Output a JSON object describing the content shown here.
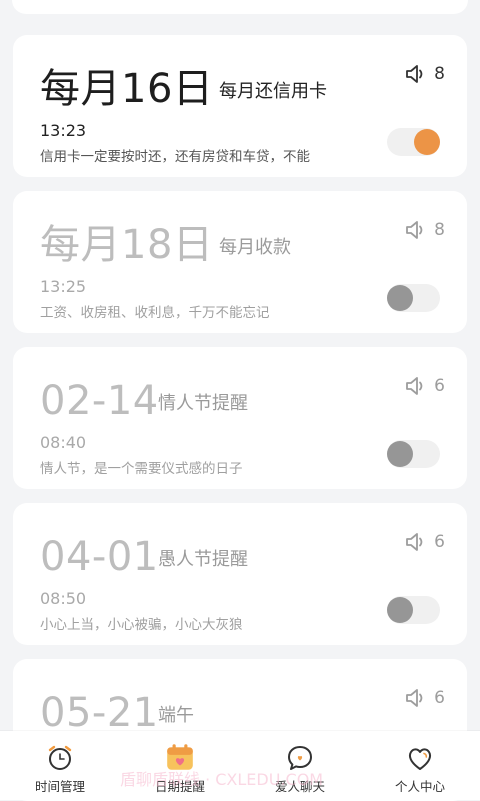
{
  "reminders": [
    {
      "date": "每月16日",
      "title": "每月还信用卡",
      "volume": "8",
      "time": "13:23",
      "note": "信用卡一定要按时还，还有房贷和车贷，不能",
      "enabled": true
    },
    {
      "date": "每月18日",
      "title": "每月收款",
      "volume": "8",
      "time": "13:25",
      "note": "工资、收房租、收利息，千万不能忘记",
      "enabled": false
    },
    {
      "date": "02-14",
      "title": "情人节提醒",
      "volume": "6",
      "time": "08:40",
      "note": "情人节，是一个需要仪式感的日子",
      "enabled": false
    },
    {
      "date": "04-01",
      "title": "愚人节提醒",
      "volume": "6",
      "time": "08:50",
      "note": "小心上当，小心被骗，小心大灰狼",
      "enabled": false
    },
    {
      "date": "05-21",
      "title": "端午",
      "volume": "6",
      "time": "",
      "note": "",
      "enabled": false
    }
  ],
  "tabs": [
    {
      "label": "时间管理",
      "icon": "alarm-clock-icon"
    },
    {
      "label": "日期提醒",
      "icon": "calendar-icon"
    },
    {
      "label": "爱人聊天",
      "icon": "chat-heart-icon"
    },
    {
      "label": "个人中心",
      "icon": "heart-icon"
    }
  ],
  "colors": {
    "accent": "#ec9446",
    "toggle_off": "#969696",
    "background": "#f3f4f6"
  },
  "watermark": "盾聊盾联线 · CXLEDU.COM"
}
